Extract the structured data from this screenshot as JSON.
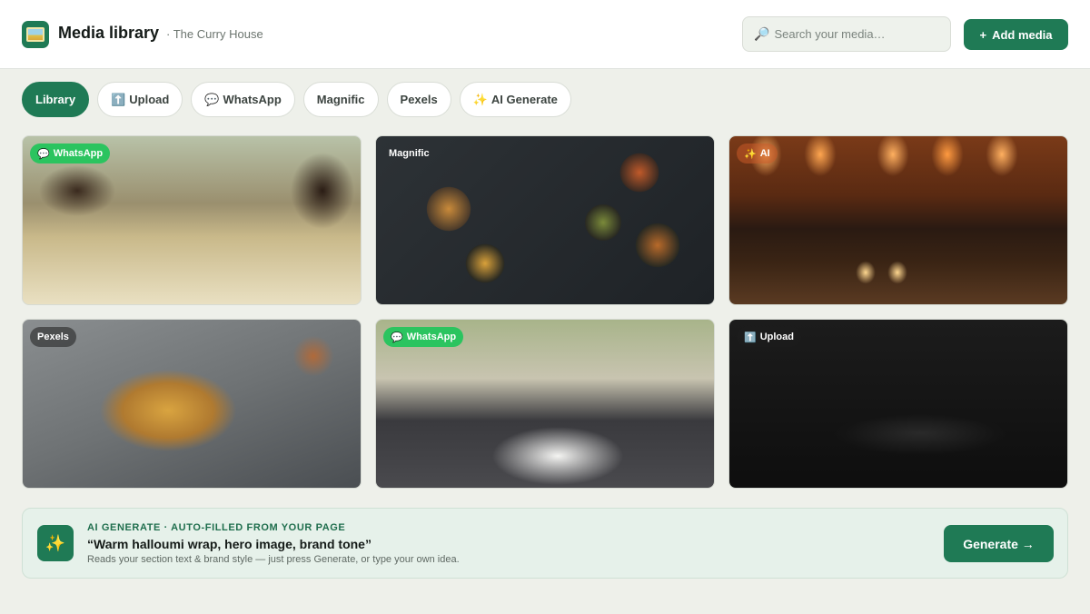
{
  "header": {
    "title": "Media library",
    "subtitle": "· The Curry House",
    "logo_icon": "image-icon",
    "search": {
      "placeholder": "Search your media…",
      "value": "",
      "icon": "search-icon"
    },
    "add_button": {
      "icon": "plus",
      "label": "Add media"
    }
  },
  "tabs": [
    {
      "label": "Library",
      "icon": "",
      "active": true
    },
    {
      "label": "Upload",
      "icon": "⬆️",
      "active": false
    },
    {
      "label": "WhatsApp",
      "icon": "💬",
      "active": false
    },
    {
      "label": "Magnific",
      "icon": "",
      "active": false
    },
    {
      "label": "Pexels",
      "icon": "",
      "active": false
    },
    {
      "label": "AI Generate",
      "icon": "✨",
      "active": false
    }
  ],
  "media": [
    {
      "badge": "WhatsApp",
      "badge_icon": "💬",
      "subject": "friends-dining-outdoors-photo"
    },
    {
      "badge": "Magnific",
      "badge_icon": "",
      "subject": "indian-food-spread-photo"
    },
    {
      "badge": "AI",
      "badge_icon": "✨",
      "subject": "candlelit-restaurant-photo"
    },
    {
      "badge": "Pexels",
      "badge_icon": "",
      "subject": "biryani-bowl-photo"
    },
    {
      "badge": "WhatsApp",
      "badge_icon": "💬",
      "subject": "qr-menu-table-photo"
    },
    {
      "badge": "Upload",
      "badge_icon": "⬆️",
      "subject": "chef-plating-dish-photo"
    }
  ],
  "ai_panel": {
    "icon": "✨",
    "kicker": "AI GENERATE · AUTO-FILLED FROM YOUR PAGE",
    "prompt": "“Warm halloumi wrap, hero image, brand tone”",
    "hint": "Reads your section text & brand style — just press Generate, or type your own idea.",
    "button_label": "Generate →"
  },
  "colors": {
    "brand": "#1f7a55",
    "whatsapp": "#2bc45f",
    "background": "#eef0ea"
  }
}
